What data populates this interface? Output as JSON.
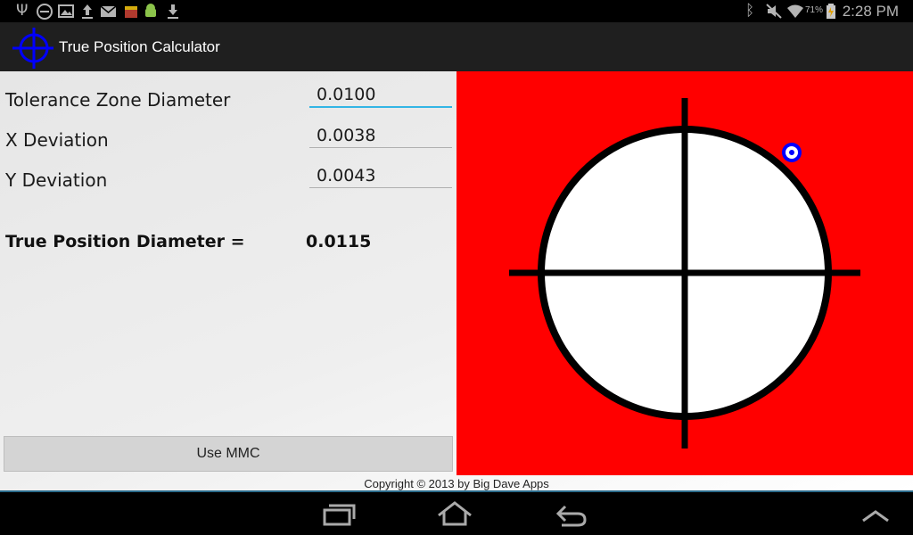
{
  "status_bar": {
    "time": "2:28 PM",
    "battery_percent": "71%",
    "icons_left": [
      "usb-icon",
      "blocked-icon",
      "image-icon",
      "upload-icon",
      "mail-icon",
      "store-icon",
      "android-icon",
      "download-icon"
    ],
    "icons_right": [
      "bluetooth-icon",
      "mute-icon",
      "wifi-icon",
      "battery-icon"
    ]
  },
  "action_bar": {
    "title": "True Position Calculator",
    "logo": "crosshair-icon",
    "logo_color": "#0000ff"
  },
  "form": {
    "tolerance": {
      "label": "Tolerance Zone Diameter",
      "value": "0.0100"
    },
    "x_dev": {
      "label": "X Deviation",
      "value": "0.0038"
    },
    "y_dev": {
      "label": "Y Deviation",
      "value": "0.0043"
    }
  },
  "result": {
    "label": "True Position Diameter =",
    "value": "0.0115"
  },
  "mmc_button": {
    "label": "Use MMC"
  },
  "visual": {
    "background": "#ff0000",
    "zone_fill": "#ffffff",
    "marker_color": "#0000ff"
  },
  "footer": {
    "copyright": "Copyright © 2013 by Big Dave Apps"
  },
  "nav_bar": {
    "buttons": [
      "recent-apps-icon",
      "home-icon",
      "back-icon",
      "menu-up-icon"
    ]
  }
}
